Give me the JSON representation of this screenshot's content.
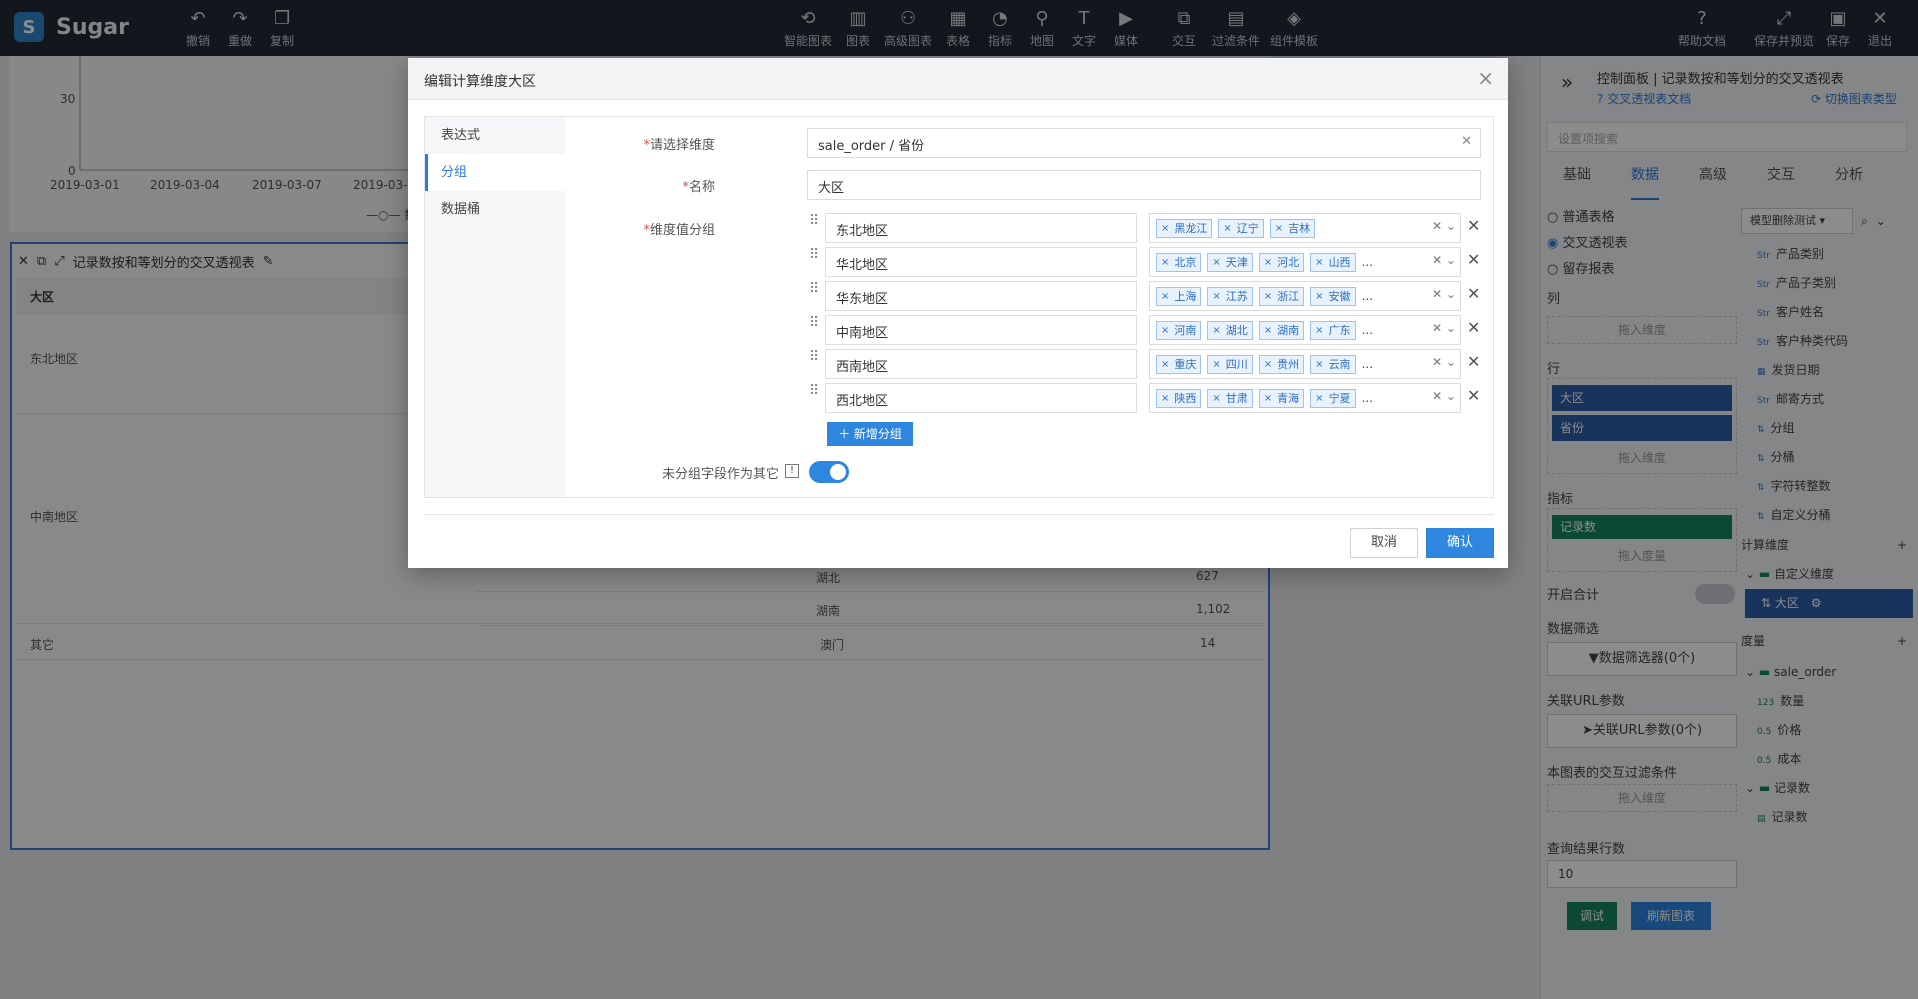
{
  "app": {
    "name": "Sugar"
  },
  "toolbar": {
    "left": [
      {
        "icon": "undo-icon",
        "label": "撤销"
      },
      {
        "icon": "redo-icon",
        "label": "重做"
      },
      {
        "icon": "copy-icon",
        "label": "复制"
      }
    ],
    "center": [
      {
        "icon": "smart-chart-icon",
        "label": "智能图表"
      },
      {
        "icon": "chart-icon",
        "label": "图表"
      },
      {
        "icon": "advanced-chart-icon",
        "label": "高级图表"
      },
      {
        "icon": "table-icon",
        "label": "表格"
      },
      {
        "icon": "metric-icon",
        "label": "指标"
      },
      {
        "icon": "map-icon",
        "label": "地图"
      },
      {
        "icon": "text-icon",
        "label": "文字"
      },
      {
        "icon": "media-icon",
        "label": "媒体"
      },
      {
        "icon": "interaction-icon",
        "label": "交互"
      },
      {
        "icon": "filter-icon",
        "label": "过滤条件"
      },
      {
        "icon": "component-template-icon",
        "label": "组件模板"
      }
    ],
    "right": [
      {
        "icon": "help-icon",
        "label": "帮助文档"
      },
      {
        "icon": "save-preview-icon",
        "label": "保存并预览"
      },
      {
        "icon": "save-icon",
        "label": "保存"
      },
      {
        "icon": "exit-icon",
        "label": "退出"
      }
    ]
  },
  "background": {
    "chart": {
      "y_tick": "30",
      "y_zero": "0",
      "x_ticks": [
        "2019-03-01",
        "2019-03-04",
        "2019-03-07",
        "2019-03-"
      ],
      "legend": "数量"
    },
    "table_card": {
      "title": "记录数按和等划分的交叉透视表",
      "col_header": "大区",
      "rows": [
        {
          "region": "东北地区",
          "province": "",
          "value": ""
        },
        {
          "region": "中南地区",
          "province": "湖北",
          "value": "627"
        },
        {
          "region": "",
          "province": "湖南",
          "value": "1,102"
        },
        {
          "region": "其它",
          "province": "澳门",
          "value": "14"
        }
      ]
    }
  },
  "right_panel": {
    "title": "控制面板 | 记录数按和等划分的交叉透视表",
    "doc_link": "交叉透视表文档",
    "switch_link": "切换图表类型",
    "search_placeholder": "设置项搜索",
    "tabs": [
      "基础",
      "数据",
      "高级",
      "交互",
      "分析"
    ],
    "active_tab": "数据",
    "table_types": [
      "普通表格",
      "交叉透视表",
      "留存报表"
    ],
    "selected_type": "交叉透视表",
    "col_label": "列",
    "drop_dimension": "拖入维度",
    "row_label": "行",
    "row_pills": [
      "大区",
      "省份"
    ],
    "metric_label": "指标",
    "metric_pill": "记录数",
    "drop_measure": "拖入度量",
    "total_label": "开启合计",
    "filter_label": "数据筛选",
    "filter_button": "数据筛选器(0个)",
    "url_label": "关联URL参数",
    "url_button": "关联URL参数(0个)",
    "interaction_filter_label": "本图表的交互过滤条件",
    "rows_label": "查询结果行数",
    "rows_value": "10",
    "debug_button": "调试",
    "refresh_button": "刷新图表",
    "model_select": "模型删除测试",
    "fields": [
      {
        "type": "Str",
        "name": "产品类别"
      },
      {
        "type": "Str",
        "name": "产品子类别"
      },
      {
        "type": "Str",
        "name": "客户姓名"
      },
      {
        "type": "Str",
        "name": "客户种类代码"
      },
      {
        "type": "Date",
        "name": "发货日期"
      },
      {
        "type": "Str",
        "name": "邮寄方式"
      },
      {
        "type": "Group",
        "name": "分组"
      },
      {
        "type": "Group",
        "name": "分桶"
      },
      {
        "type": "Group",
        "name": "字符转整数"
      },
      {
        "type": "Group",
        "name": "自定义分桶"
      }
    ],
    "calc_dim_label": "计算维度",
    "custom_dim_folder": "自定义维度",
    "custom_dim_item": "大区",
    "measure_label": "度量",
    "measure_folder": "sale_order",
    "measures": [
      {
        "type": "123",
        "name": "数量"
      },
      {
        "type": "0.5",
        "name": "价格"
      },
      {
        "type": "0.5",
        "name": "成本"
      }
    ],
    "record_folder": "记录数",
    "record_item": "记录数"
  },
  "modal": {
    "title": "编辑计算维度大区",
    "side_items": [
      "表达式",
      "分组",
      "数据桶"
    ],
    "active_side": "分组",
    "dimension_label": "请选择维度",
    "dimension_value": "sale_order / 省份",
    "name_label": "名称",
    "name_value": "大区",
    "groups_label": "维度值分组",
    "groups": [
      {
        "name": "东北地区",
        "values": [
          "黑龙江",
          "辽宁",
          "吉林"
        ],
        "more": ""
      },
      {
        "name": "华北地区",
        "values": [
          "北京",
          "天津",
          "河北",
          "山西"
        ],
        "more": "..."
      },
      {
        "name": "华东地区",
        "values": [
          "上海",
          "江苏",
          "浙江",
          "安徽"
        ],
        "more": "..."
      },
      {
        "name": "中南地区",
        "values": [
          "河南",
          "湖北",
          "湖南",
          "广东"
        ],
        "more": "..."
      },
      {
        "name": "西南地区",
        "values": [
          "重庆",
          "四川",
          "贵州",
          "云南"
        ],
        "more": "..."
      },
      {
        "name": "西北地区",
        "values": [
          "陕西",
          "甘肃",
          "青海",
          "宁夏"
        ],
        "more": "..."
      }
    ],
    "add_group": "新增分组",
    "other_label": "未分组字段作为其它",
    "other_enabled": true,
    "cancel": "取消",
    "confirm": "确认"
  }
}
